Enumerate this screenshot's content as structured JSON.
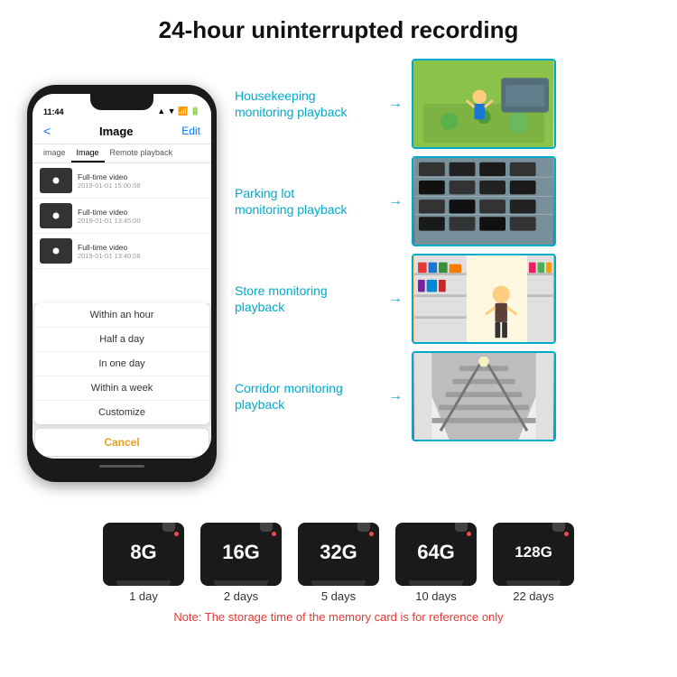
{
  "header": {
    "title": "24-hour uninterrupted recording"
  },
  "phone": {
    "status_time": "11:44",
    "nav_back": "<",
    "nav_title": "Image",
    "nav_edit": "Edit",
    "tabs": [
      "image",
      "Image",
      "Remote playback"
    ],
    "list_items": [
      {
        "title": "Full-time video",
        "date": "2019-01-01 15:00:08"
      },
      {
        "title": "Full-time video",
        "date": "2019-01-01 13:45:00"
      },
      {
        "title": "Full-time video",
        "date": "2019-01-01 13:40:08"
      }
    ],
    "dropdown": [
      "Within an hour",
      "Half a day",
      "In one day",
      "Within a week",
      "Customize"
    ],
    "cancel": "Cancel"
  },
  "monitoring": [
    {
      "label": "Housekeeping\nmonitoring playback",
      "photo_type": "housekeeping"
    },
    {
      "label": "Parking lot\nmonitoring playback",
      "photo_type": "parking"
    },
    {
      "label": "Store monitoring\nplayback",
      "photo_type": "store"
    },
    {
      "label": "Corridor monitoring\nplayback",
      "photo_type": "corridor"
    }
  ],
  "storage": {
    "cards": [
      {
        "size": "8G",
        "days": "1 day"
      },
      {
        "size": "16G",
        "days": "2 days"
      },
      {
        "size": "32G",
        "days": "5 days"
      },
      {
        "size": "64G",
        "days": "10 days"
      },
      {
        "size": "128G",
        "days": "22 days"
      }
    ],
    "note": "Note: The storage time of the memory card is for reference only"
  }
}
